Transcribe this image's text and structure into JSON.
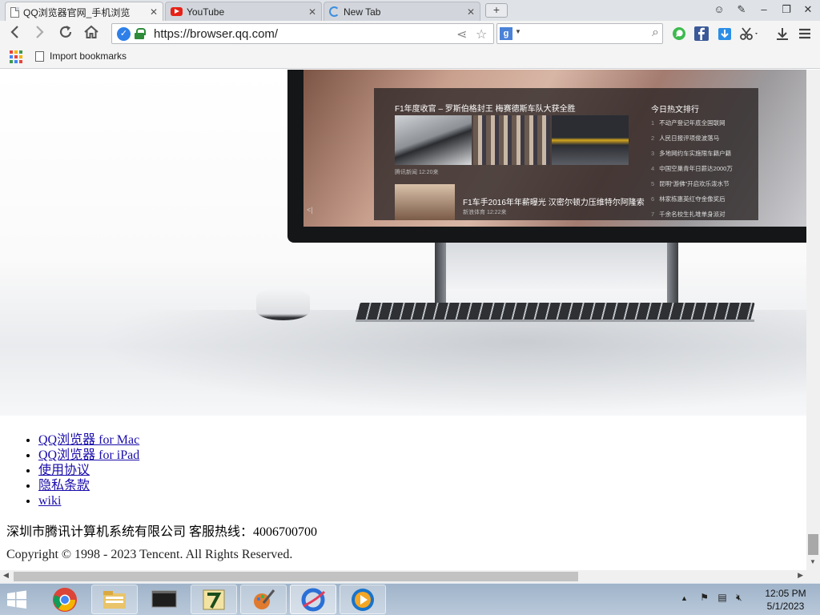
{
  "tabs": [
    {
      "title": "QQ浏览器官网_手机浏览",
      "icon": "page-icon",
      "active": true
    },
    {
      "title": "YouTube",
      "icon": "youtube-icon",
      "active": false
    },
    {
      "title": "New Tab",
      "icon": "loading-icon",
      "active": false
    }
  ],
  "new_tab_label": "+",
  "window_controls": {
    "chat": "☺",
    "pin": "✎",
    "minimize": "–",
    "restore": "❐",
    "close": "✕"
  },
  "toolbar": {
    "url": "https://browser.qq.com/",
    "search_engine_label": "g",
    "search_value": ""
  },
  "bookmarks": {
    "import_label": "Import bookmarks"
  },
  "hero": {
    "headline": "F1年度收官 – 罗斯伯格封王 梅赛德斯车队大获全胜",
    "source1": "腾讯新闻  12:20来",
    "headline2": "F1车手2016年年薪曝光 汉密尔顿力压维特尔阿隆索",
    "source2": "新浪体育  12:22来",
    "hot_title": "今日热文排行",
    "hot_items": [
      {
        "num": "1",
        "text": "不动产登记年底全国联网"
      },
      {
        "num": "2",
        "text": "人民日报评项俊波落马"
      },
      {
        "num": "3",
        "text": "多地网约车实施限车籍户籍"
      },
      {
        "num": "4",
        "text": "中国空巢青年日薪达2000万"
      },
      {
        "num": "5",
        "text": "昆明“游佛”开启欢乐泼水节"
      },
      {
        "num": "6",
        "text": "林家栋惠英红夺金像奖后"
      },
      {
        "num": "7",
        "text": "千余名校生扎堆单身派对"
      }
    ],
    "panel_arrow": "<|"
  },
  "footer": {
    "links": [
      "QQ浏览器 for Mac",
      "QQ浏览器 for iPad",
      "使用协议",
      "隐私条款",
      "wiki"
    ],
    "company": "深圳市腾讯计算机系统有限公司 客服热线：4006700700",
    "copyright": "Copyright © 1998 - 2023 Tencent. All Rights Reserved."
  },
  "taskbar": {
    "apps": [
      "chrome-icon",
      "file-explorer-icon",
      "terminal-icon",
      "7zip-icon",
      "paint-icon",
      "qq-browser-icon",
      "media-player-icon"
    ],
    "time": "12:05 PM",
    "date": "5/1/2023"
  },
  "colors": {
    "link": "#1a0dab",
    "omnibox_shield": "#2f7fe8",
    "lock": "#2e8b3a",
    "taskbar": "#b1c3d6"
  }
}
